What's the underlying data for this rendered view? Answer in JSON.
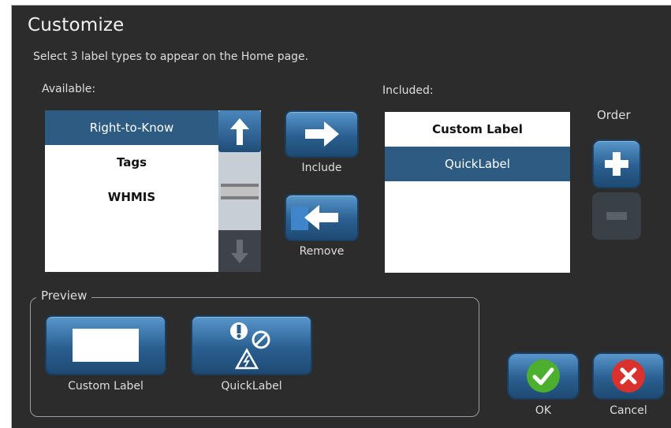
{
  "dialog": {
    "title": "Customize",
    "subtitle": "Select 3 label types to appear on the Home page."
  },
  "available": {
    "label": "Available:",
    "items": [
      "Right-to-Know",
      "Tags",
      "WHMIS"
    ]
  },
  "included": {
    "label": "Included:",
    "items": [
      "Custom Label",
      "QuickLabel"
    ]
  },
  "order": {
    "label": "Order"
  },
  "actions": {
    "include_label": "Include",
    "remove_label": "Remove"
  },
  "preview": {
    "legend": "Preview",
    "items": [
      {
        "label": "Custom Label",
        "icon": "blank-label-icon"
      },
      {
        "label": "QuickLabel",
        "icon": "hazard-symbols-icon"
      }
    ]
  },
  "footer": {
    "ok_label": "OK",
    "cancel_label": "Cancel"
  },
  "colors": {
    "background": "#2c2c2c",
    "selected": "#2d5b82",
    "button_blue": "#2a5f90",
    "ok_green": "#4caf2e",
    "cancel_red": "#d9312d"
  }
}
